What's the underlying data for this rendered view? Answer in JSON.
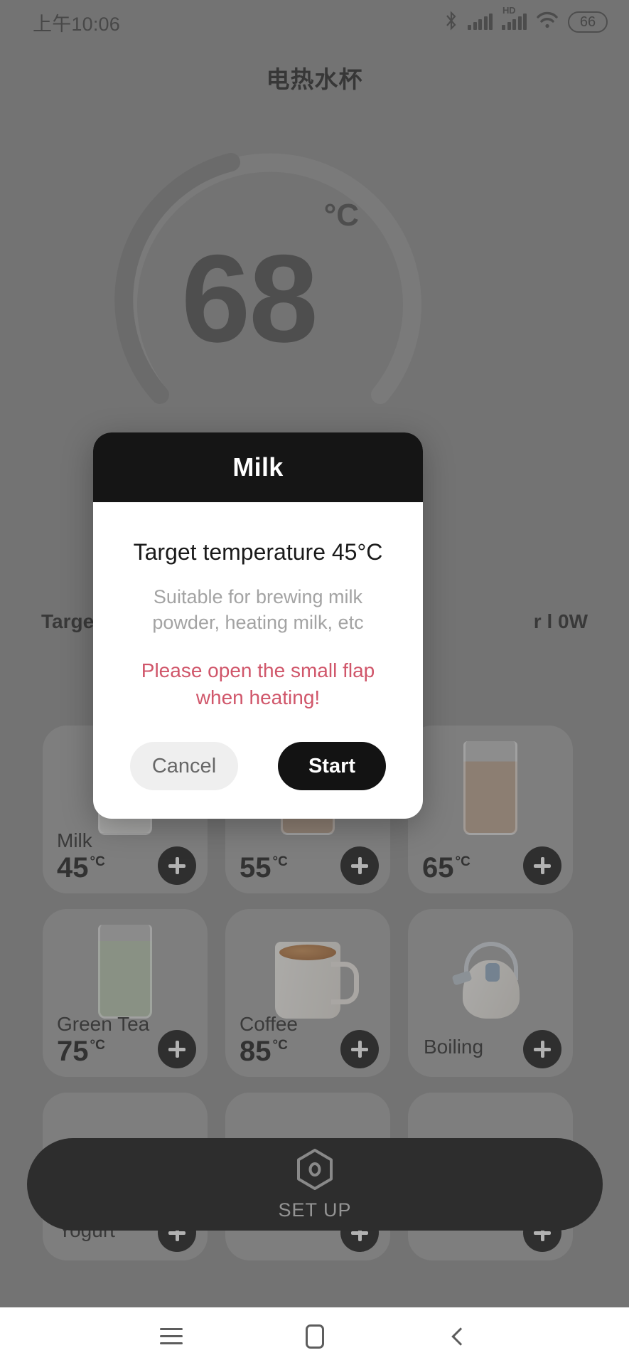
{
  "status_bar": {
    "time": "上午10:06",
    "bluetooth_icon": "bluetooth-icon",
    "signal_icon": "signal-bars-icon",
    "hd_label": "HD",
    "signal2_icon": "signal-bars-icon",
    "wifi_icon": "wifi-icon",
    "battery_level": "66"
  },
  "app": {
    "title": "电热水杯",
    "gauge": {
      "temperature": "68",
      "unit": "°C",
      "progress_percent": 35
    },
    "info": {
      "left_label": "Target",
      "right_label": "r l 0W"
    },
    "presets": [
      {
        "name": "Milk",
        "temp": "45",
        "unit": "°C",
        "art": "glass-milk",
        "add_label": "+"
      },
      {
        "name": "",
        "temp": "55",
        "unit": "°C",
        "art": "glass-juice",
        "add_label": "+"
      },
      {
        "name": "",
        "temp": "65",
        "unit": "°C",
        "art": "glass-juice",
        "add_label": "+"
      },
      {
        "name": "Green Tea",
        "temp": "75",
        "unit": "°C",
        "art": "glass-tea",
        "add_label": "+"
      },
      {
        "name": "Coffee",
        "temp": "85",
        "unit": "°C",
        "art": "mug-coffee",
        "add_label": "+"
      },
      {
        "name": "Boiling",
        "temp": "",
        "unit": "",
        "art": "kettle",
        "add_label": "+"
      },
      {
        "name": "Yogurt",
        "temp": "",
        "unit": "",
        "art": "bowl",
        "add_label": "+"
      },
      {
        "name": "",
        "temp": "",
        "unit": "",
        "art": "bowl",
        "add_label": "+"
      },
      {
        "name": "",
        "temp": "",
        "unit": "",
        "art": "bowl",
        "add_label": "+"
      }
    ],
    "setup_button": {
      "label": "SET UP",
      "icon": "hexagon-gear-icon"
    }
  },
  "dialog": {
    "title": "Milk",
    "target_line": "Target temperature 45°C",
    "description": "Suitable for brewing milk powder, heating milk, etc",
    "warning": "Please open the small flap when heating!",
    "cancel_label": "Cancel",
    "start_label": "Start"
  },
  "nav_bar": {
    "recents_icon": "menu-icon",
    "home_icon": "home-square-icon",
    "back_icon": "back-chevron-icon"
  },
  "colors": {
    "accent_dark": "#131313",
    "warning_red": "#d0566a",
    "background": "#8c8c8c"
  }
}
